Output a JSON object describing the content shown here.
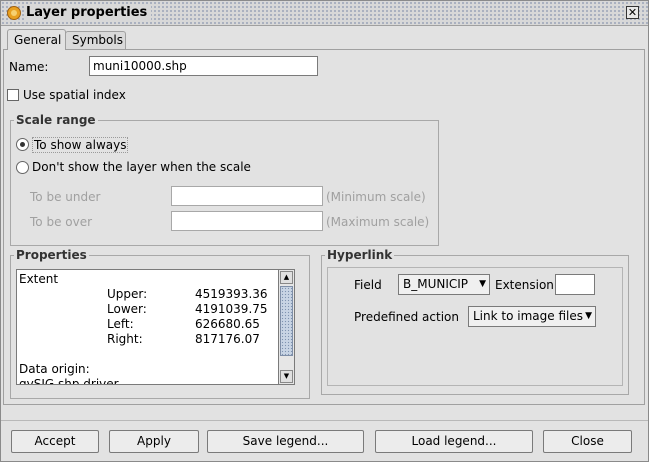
{
  "window": {
    "title": "Layer properties",
    "close_glyph": "✕"
  },
  "tabs": [
    {
      "label": "General"
    },
    {
      "label": "Symbols"
    }
  ],
  "name": {
    "label": "Name:",
    "value": "muni10000.shp"
  },
  "spatial_index": {
    "label": "Use spatial index",
    "checked": false
  },
  "scale_range": {
    "title": "Scale range",
    "option_always": "To show always",
    "option_scale": "Don't show the layer when the scale",
    "under_label": "To be under",
    "under_hint": "(Minimum scale)",
    "over_label": "To be over",
    "over_hint": "(Maximum scale)"
  },
  "properties": {
    "title": "Properties",
    "extent_label": "Extent",
    "rows": [
      {
        "label": "Upper:",
        "value": "4519393.36"
      },
      {
        "label": "Lower:",
        "value": "4191039.75"
      },
      {
        "label": "Left:",
        "value": "626680.65"
      },
      {
        "label": "Right:",
        "value": "817176.07"
      }
    ],
    "data_origin_label": "Data origin:",
    "data_origin_value": "gvSIG shp driver"
  },
  "hyperlink": {
    "title": "Hyperlink",
    "field_label": "Field",
    "field_value": "B_MUNICIP",
    "extension_label": "Extension",
    "extension_value": "",
    "action_label": "Predefined action",
    "action_value": "Link to image files"
  },
  "buttons": {
    "accept": "Accept",
    "apply": "Apply",
    "save_legend": "Save legend...",
    "load_legend": "Load legend...",
    "close": "Close"
  },
  "icons": {
    "app": "gvsig-app-icon",
    "close": "close-icon",
    "combo_arrow": "▼",
    "scroll_up": "▲",
    "scroll_down": "▼"
  }
}
